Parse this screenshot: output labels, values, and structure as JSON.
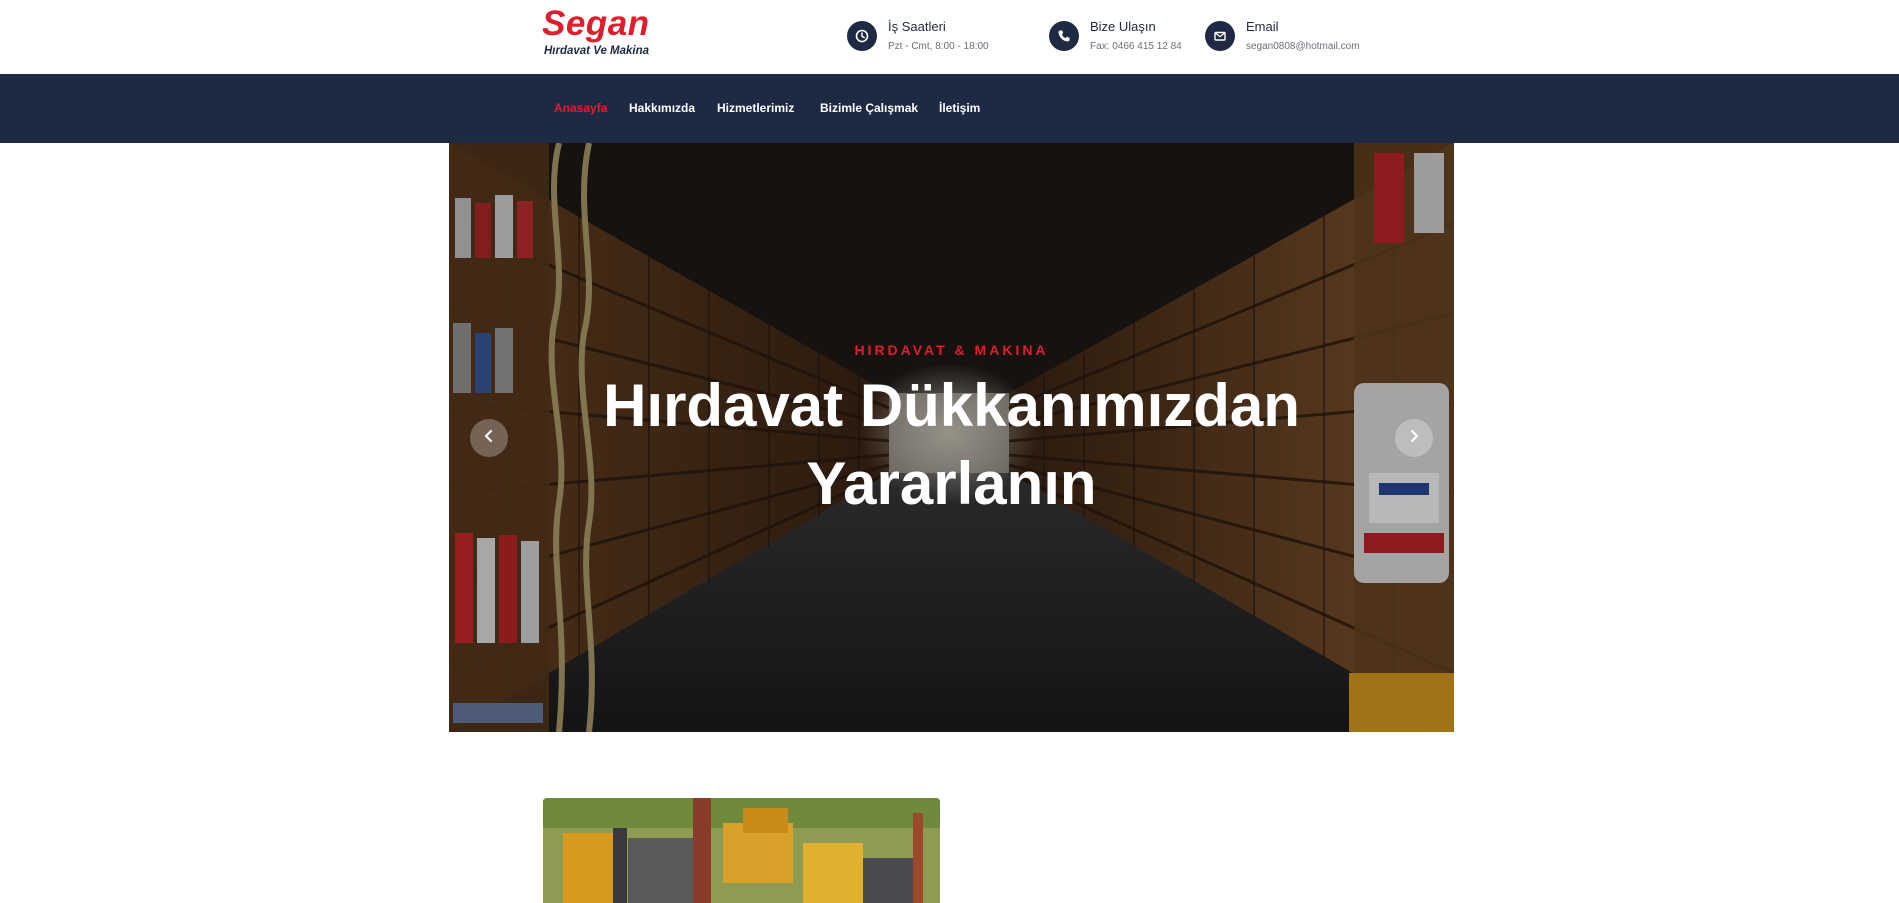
{
  "brand": {
    "name": "Segan",
    "tagline": "Hırdavat Ve Makina",
    "accent_color": "#e01e2b",
    "navy_color": "#1e2a44"
  },
  "header_info": [
    {
      "icon": "clock-icon",
      "title": "İş Saatleri",
      "text": "Pzt - Cmt, 8:00 - 18:00"
    },
    {
      "icon": "phone-icon",
      "title": "Bize Ulaşın",
      "text": "Fax: 0466 415 12 84"
    },
    {
      "icon": "envelope-icon",
      "title": "Email",
      "text": "segan0808@hotmail.com"
    }
  ],
  "nav": {
    "items": [
      {
        "label": "Anasayfa",
        "active": true
      },
      {
        "label": "Hakkımızda",
        "active": false
      },
      {
        "label": "Hizmetlerimiz",
        "active": false
      },
      {
        "label": "Bizimle Çalışmak",
        "active": false
      },
      {
        "label": "İletişim",
        "active": false
      }
    ]
  },
  "hero": {
    "eyebrow": "HIRDAVAT & MAKINA",
    "title": "Hırdavat Dükkanımızdan Yararlanın",
    "prev_icon": "chevron-left-icon",
    "next_icon": "chevron-right-icon"
  }
}
